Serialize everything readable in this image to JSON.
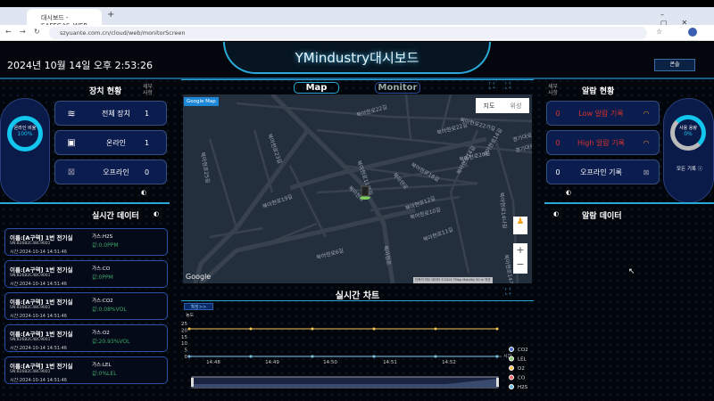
{
  "browser": {
    "tab_title": "대시보드 - SAFEGAS_WEB",
    "url": "szyuante.com.cn/cloud/web/monitorScreen"
  },
  "header": {
    "title": "YMindustry대시보드",
    "datetime": "2024년 10월 14일 오후 2:53:26",
    "console_label": "콘솔"
  },
  "device_status": {
    "title": "장치 현황",
    "detail_label": "세부 사항",
    "online_rate_label": "온라인 비율",
    "online_rate": "100%",
    "online_rate_value": 100,
    "items": [
      {
        "label": "전체 장치",
        "count": "1",
        "icon": "layers-icon"
      },
      {
        "label": "온라인",
        "count": "1",
        "icon": "monitor-check-icon"
      },
      {
        "label": "오프라인",
        "count": "0",
        "icon": "monitor-x-icon"
      }
    ]
  },
  "realtime_data": {
    "title": "실시간 데이터",
    "cards": [
      {
        "name": "이름:[A구역] 1번 전기실",
        "sn": "SN:82682C48C9001",
        "time": "시간:2024-10-14 14:51:46",
        "gas": "가스:H2S",
        "value": "값:0.0PPM"
      },
      {
        "name": "이름:[A구역] 1번 전기실",
        "sn": "SN:82682C48C9001",
        "time": "시간:2024-10-14 14:51:46",
        "gas": "가스:CO",
        "value": "값:0PPM"
      },
      {
        "name": "이름:[A구역] 1번 전기실",
        "sn": "SN:82682C48C9001",
        "time": "시간:2024-10-14 14:51:46",
        "gas": "가스:CO2",
        "value": "값:0.08%VOL"
      },
      {
        "name": "이름:[A구역] 1번 전기실",
        "sn": "SN:82682C48C9001",
        "time": "시간:2024-10-14 14:51:46",
        "gas": "가스:O2",
        "value": "값:20.93%VOL"
      },
      {
        "name": "이름:[A구역] 1번 전기실",
        "sn": "SN:82682C48C9001",
        "time": "시간:2024-10-14 14:51:46",
        "gas": "가스:LEL",
        "value": "값:0%LEL"
      }
    ]
  },
  "center": {
    "tab_map": "Map",
    "tab_monitor": "Monitor",
    "map_badge": "Google Map",
    "map_type": [
      "지도",
      "위성"
    ],
    "google": "Google",
    "attribution": "단축키  지도 데이터 ©2024 TMap Mobility  50 m  약관",
    "streets": [
      "북아현로22길",
      "북아현로22길",
      "북아현로20길",
      "북아현로",
      "북아현로19길",
      "북아현로23길",
      "북아현로25길",
      "북아현로11가길",
      "북아현로",
      "북아현로18길",
      "북아현로14길",
      "북아현로12길",
      "북아현로10길",
      "북아현로11길",
      "북아현로6길",
      "북아현로",
      "북아현로14나길",
      "북아현로14가길",
      "경기대로9길",
      "경기대로",
      "북아현로14길",
      "북아현로22가길"
    ]
  },
  "alarm_status": {
    "title": "알람 현황",
    "detail_label": "세부 사항",
    "usage_label": "사용 용량",
    "usage": "0%",
    "usage_value": 0,
    "all_records": "모든 기록",
    "items": [
      {
        "count": "0",
        "label": "Low 알람 기록",
        "color": "#d9332b"
      },
      {
        "count": "0",
        "label": "High 알람 기록",
        "color": "#d9332b"
      },
      {
        "count": "0",
        "label": "오프라인 기록",
        "color": "#ffffff"
      }
    ]
  },
  "alarm_data": {
    "title": "알람 데이터"
  },
  "chart_data": {
    "type": "line",
    "title": "실시간 차트",
    "expand_label": "확장>>",
    "ylabel": "농도",
    "xlabel": "시간",
    "ylim": [
      0,
      25
    ],
    "yticks": [
      "25",
      "20",
      "15",
      "10",
      "5",
      "0"
    ],
    "xticks": [
      "14:48",
      "14:49",
      "14:50",
      "14:51",
      "14:52"
    ],
    "x": [
      "14:47:36",
      "14:48:38",
      "14:49:40",
      "14:50:42",
      "14:51:44",
      "14:52:46"
    ],
    "series": [
      {
        "name": "CO2",
        "color": "#5470c6",
        "values": [
          0.08,
          0.08,
          0.08,
          0.08,
          0.08,
          0.08
        ]
      },
      {
        "name": "LEL",
        "color": "#91cc75",
        "values": [
          0,
          0,
          0,
          0,
          0,
          0
        ]
      },
      {
        "name": "O2",
        "color": "#fac858",
        "values": [
          20.93,
          20.93,
          20.93,
          20.93,
          20.93,
          20.93
        ]
      },
      {
        "name": "CO",
        "color": "#ee6666",
        "values": [
          0,
          0,
          0,
          0,
          0,
          0
        ]
      },
      {
        "name": "H2S",
        "color": "#73c0de",
        "values": [
          0,
          0,
          0,
          0,
          0,
          0
        ]
      }
    ]
  }
}
